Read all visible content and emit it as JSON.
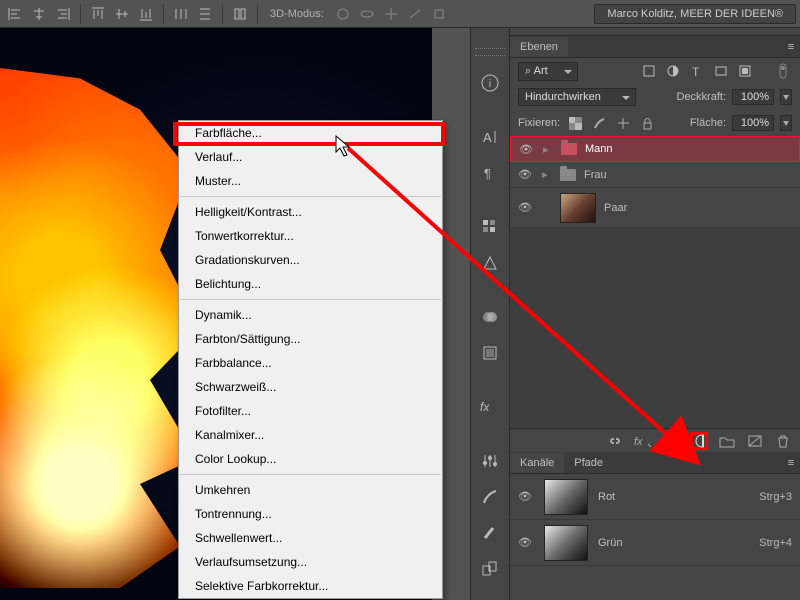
{
  "optbar": {
    "mode3d_label": "3D-Modus:",
    "user": "Marco Kolditz, MEER DER IDEEN®"
  },
  "context_menu": {
    "groups": [
      [
        "Farbfläche...",
        "Verlauf...",
        "Muster..."
      ],
      [
        "Helligkeit/Kontrast...",
        "Tonwertkorrektur...",
        "Gradationskurven...",
        "Belichtung..."
      ],
      [
        "Dynamik...",
        "Farbton/Sättigung...",
        "Farbbalance...",
        "Schwarzweiß...",
        "Fotofilter...",
        "Kanalmixer...",
        "Color Lookup..."
      ],
      [
        "Umkehren",
        "Tontrennung...",
        "Schwellenwert...",
        "Verlaufsumsetzung...",
        "Selektive Farbkorrektur..."
      ]
    ],
    "highlighted": "Farbfläche..."
  },
  "layers_panel": {
    "tab": "Ebenen",
    "filter_label": "Art",
    "blend_mode": "Hindurchwirken",
    "opacity_label": "Deckkraft:",
    "opacity_value": "100%",
    "lock_label": "Fixieren:",
    "fill_label": "Fläche:",
    "fill_value": "100%",
    "layers": [
      {
        "name": "Mann",
        "type": "folder",
        "selected": true,
        "color": "red"
      },
      {
        "name": "Frau",
        "type": "folder",
        "selected": false
      },
      {
        "name": "Paar",
        "type": "image",
        "selected": false
      }
    ]
  },
  "channels_panel": {
    "tabs": [
      "Kanäle",
      "Pfade"
    ],
    "active": "Kanäle",
    "channels": [
      {
        "name": "Rot",
        "shortcut": "Strg+3"
      },
      {
        "name": "Grün",
        "shortcut": "Strg+4"
      }
    ]
  }
}
